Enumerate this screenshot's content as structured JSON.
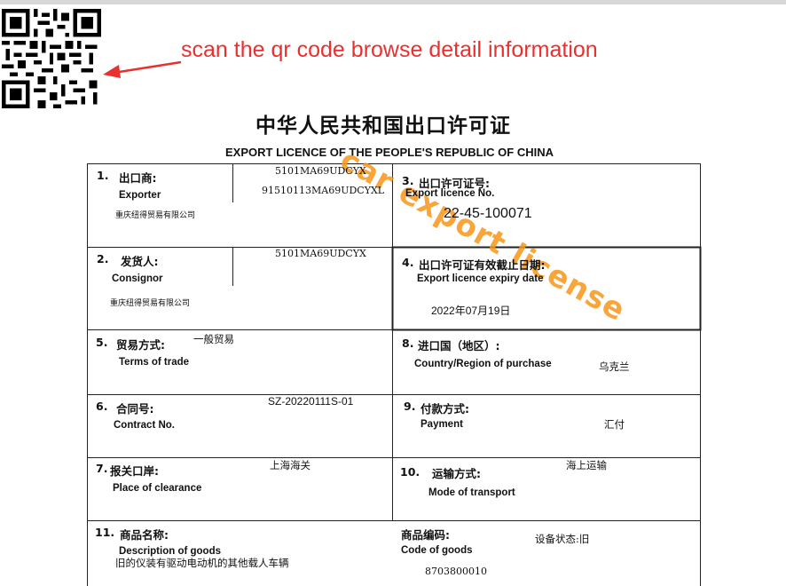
{
  "qr_icon": "qr-code-icon",
  "arrow_icon": "arrow-left-icon",
  "note_color": "#e8312f",
  "watermark_color": "#f89619",
  "note": "scan the qr code browse detail information",
  "title_cn": "中华人民共和国出口许可证",
  "title_en": "EXPORT LICENCE OF THE PEOPLE'S REPUBLIC OF CHINA",
  "watermark": "car export license",
  "fields": {
    "exporter": {
      "num": "1.",
      "cn": "出口商:",
      "en": "Exporter",
      "code1": "5101MA69UDCYX",
      "code2": "91510113MA69UDCYXL",
      "name": "重庆纽得贸易有限公司"
    },
    "licence_no": {
      "num": "3.",
      "cn": "出口许可证号:",
      "en": "Export  licence No.",
      "value": "22-45-100071"
    },
    "consignor": {
      "num": "2.",
      "cn": "发货人:",
      "en": "Consignor",
      "code": "5101MA69UDCYX",
      "name": "重庆纽得贸易有限公司"
    },
    "expiry": {
      "num": "4.",
      "cn": "出口许可证有效截止日期:",
      "en": "Export licence expiry date",
      "value": "2022年07月19日"
    },
    "trade_terms": {
      "num": "5.",
      "cn": "贸易方式:",
      "en": "Terms of trade",
      "value": "一般贸易"
    },
    "country": {
      "num": "8.",
      "cn": "进口国（地区）:",
      "en": "Country/Region of purchase",
      "value": "乌克兰"
    },
    "contract": {
      "num": "6.",
      "cn": "合同号:",
      "en": "Contract No.",
      "value": "SZ-20220111S-01"
    },
    "payment": {
      "num": "9.",
      "cn": "付款方式:",
      "en": "Payment",
      "value": "汇付"
    },
    "clearance": {
      "num": "7.",
      "cn": "报关口岸:",
      "en": "Place of clearance",
      "value": "上海海关"
    },
    "transport": {
      "num": "10.",
      "cn": "运输方式:",
      "en": "Mode of transport",
      "value": "海上运输"
    },
    "goods": {
      "num": "11.",
      "cn": "商品名称:",
      "en": "Description of goods",
      "value": "旧的仪装有驱动电动机的其他载人车辆",
      "code_cn": "商品编码:",
      "code_en": "Code of goods",
      "code_value": "8703800010",
      "status": "设备状态:旧"
    }
  }
}
